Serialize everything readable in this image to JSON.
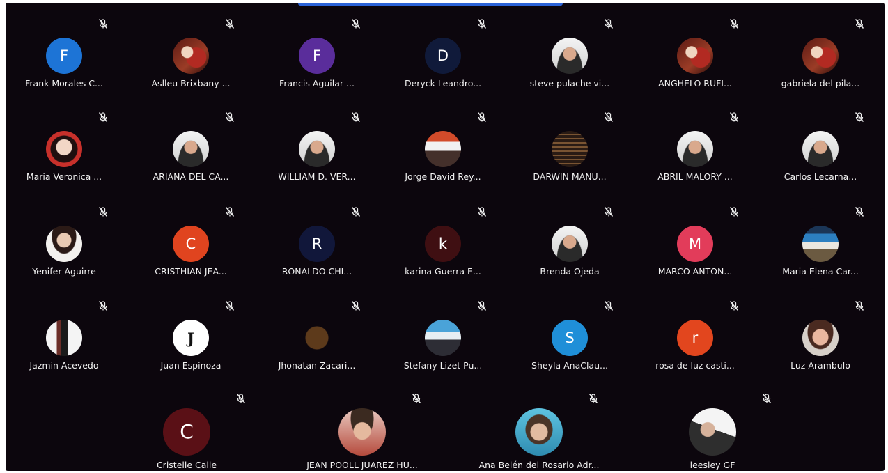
{
  "participants": [
    {
      "name": "Frank Morales C...",
      "initial": "F",
      "color": "#1d74d6",
      "muted": true
    },
    {
      "name": "Aslleu Brixbany ...",
      "initial": "",
      "color": "",
      "muted": true
    },
    {
      "name": "Francis Aguilar ...",
      "initial": "F",
      "color": "#5a2d9b",
      "muted": true
    },
    {
      "name": "Deryck Leandro...",
      "initial": "D",
      "color": "#101a3a",
      "muted": true
    },
    {
      "name": "steve pulache vi...",
      "initial": "",
      "color": "",
      "muted": true
    },
    {
      "name": "ANGHELO RUFI...",
      "initial": "",
      "color": "",
      "muted": true
    },
    {
      "name": "gabriela del pila...",
      "initial": "",
      "color": "",
      "muted": true
    },
    {
      "name": "Maria Veronica ...",
      "initial": "",
      "color": "",
      "muted": true
    },
    {
      "name": "ARIANA DEL CA...",
      "initial": "",
      "color": "",
      "muted": true
    },
    {
      "name": "WILLIAM D. VER...",
      "initial": "",
      "color": "",
      "muted": true
    },
    {
      "name": "Jorge David Rey...",
      "initial": "",
      "color": "",
      "muted": true
    },
    {
      "name": "DARWIN MANU...",
      "initial": "",
      "color": "",
      "muted": true
    },
    {
      "name": "ABRIL MALORY ...",
      "initial": "",
      "color": "",
      "muted": true
    },
    {
      "name": "Carlos Lecarna...",
      "initial": "",
      "color": "",
      "muted": true
    },
    {
      "name": "Yenifer Aguirre",
      "initial": "",
      "color": "",
      "muted": true
    },
    {
      "name": "CRISTHIAN JEA...",
      "initial": "C",
      "color": "#e0441f",
      "muted": true
    },
    {
      "name": "RONALDO CHI...",
      "initial": "R",
      "color": "#11173a",
      "muted": true
    },
    {
      "name": "karina Guerra E...",
      "initial": "k",
      "color": "#3f0f12",
      "muted": true
    },
    {
      "name": "Brenda Ojeda",
      "initial": "",
      "color": "",
      "muted": true
    },
    {
      "name": "MARCO ANTON...",
      "initial": "M",
      "color": "#e23c5a",
      "muted": true
    },
    {
      "name": "Maria Elena Car...",
      "initial": "",
      "color": "",
      "muted": true
    },
    {
      "name": "Jazmin Acevedo",
      "initial": "",
      "color": "",
      "muted": true
    },
    {
      "name": "Juan Espinoza",
      "initial": "J",
      "color": "#ffffff",
      "muted": true
    },
    {
      "name": "Jhonatan Zacari...",
      "initial": "",
      "color": "",
      "muted": true
    },
    {
      "name": "Stefany Lizet Pu...",
      "initial": "",
      "color": "",
      "muted": true
    },
    {
      "name": "Sheyla AnaClau...",
      "initial": "S",
      "color": "#1f8fd8",
      "muted": true
    },
    {
      "name": "rosa de luz casti...",
      "initial": "r",
      "color": "#e2461e",
      "muted": true
    },
    {
      "name": "Luz Arambulo",
      "initial": "",
      "color": "",
      "muted": true
    },
    {
      "name": "Cristelle Calle",
      "initial": "C",
      "color": "#5a1016",
      "muted": true
    },
    {
      "name": "JEAN POOLL JUAREZ HU...",
      "initial": "",
      "color": "",
      "muted": true
    },
    {
      "name": "Ana Belén del Rosario Adr...",
      "initial": "",
      "color": "",
      "muted": true
    },
    {
      "name": "leesley GF",
      "initial": "",
      "color": "",
      "muted": true
    }
  ],
  "icons": {
    "mute": "microphone-off-icon"
  }
}
